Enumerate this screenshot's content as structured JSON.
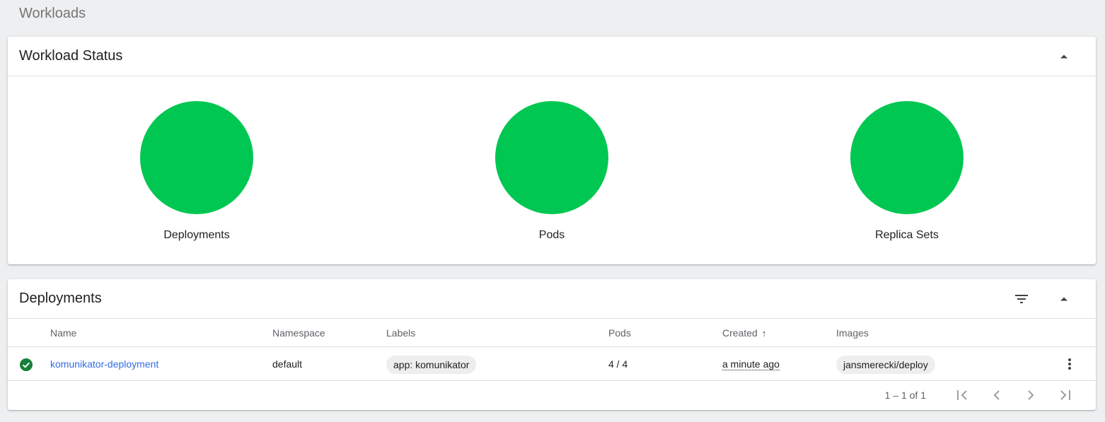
{
  "page": {
    "title": "Workloads"
  },
  "workload_status": {
    "title": "Workload Status",
    "success_color": "#00c752",
    "items": [
      {
        "label": "Deployments",
        "ratio": 1.0
      },
      {
        "label": "Pods",
        "ratio": 1.0
      },
      {
        "label": "Replica Sets",
        "ratio": 1.0
      }
    ]
  },
  "deployments": {
    "title": "Deployments",
    "columns": {
      "name": "Name",
      "namespace": "Namespace",
      "labels": "Labels",
      "pods": "Pods",
      "created": "Created",
      "created_sort": "↑",
      "images": "Images"
    },
    "rows": [
      {
        "status": "running",
        "status_icon": "check-circle-icon",
        "status_color": "#188038",
        "name": "komunikator-deployment",
        "namespace": "default",
        "label": "app: komunikator",
        "pods": "4 / 4",
        "created": "a minute ago",
        "image": "jansmerecki/deploy"
      }
    ],
    "pagination": {
      "range": "1 – 1 of 1"
    }
  }
}
